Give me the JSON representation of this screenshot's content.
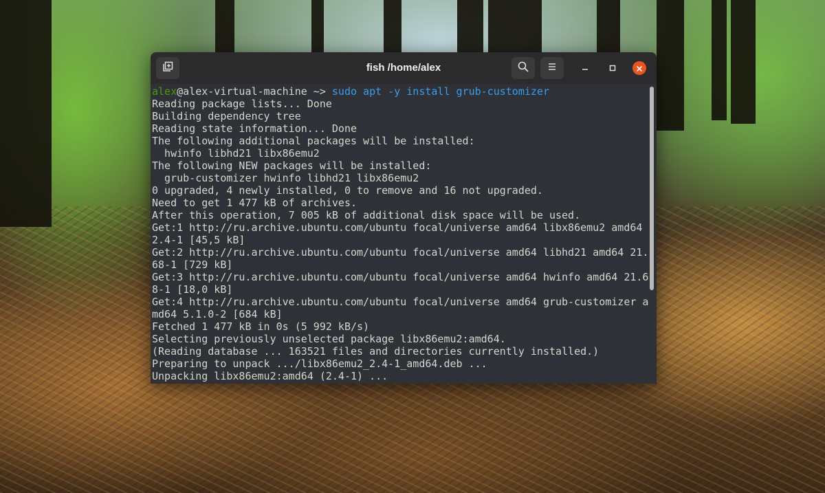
{
  "window": {
    "title": "fish /home/alex"
  },
  "colors": {
    "prompt_user": "#4e9a06",
    "command": "#3a9ded",
    "text": "#d3d7cf",
    "terminal_bg": "#2f3136",
    "close_button": "#e95420"
  },
  "icons": {
    "new_tab": "new-tab-icon",
    "search": "search-icon",
    "menu": "hamburger-menu-icon",
    "minimize": "minimize-icon",
    "maximize": "maximize-icon",
    "close": "close-icon"
  },
  "terminal": {
    "prompt_user": "alex",
    "prompt_rest": "@alex-virtual-machine ~> ",
    "command": "sudo apt -y install grub-customizer",
    "output": [
      "Reading package lists... Done",
      "Building dependency tree",
      "Reading state information... Done",
      "The following additional packages will be installed:",
      "  hwinfo libhd21 libx86emu2",
      "The following NEW packages will be installed:",
      "  grub-customizer hwinfo libhd21 libx86emu2",
      "0 upgraded, 4 newly installed, 0 to remove and 16 not upgraded.",
      "Need to get 1 477 kB of archives.",
      "After this operation, 7 005 kB of additional disk space will be used.",
      "Get:1 http://ru.archive.ubuntu.com/ubuntu focal/universe amd64 libx86emu2 amd64",
      "2.4-1 [45,5 kB]",
      "Get:2 http://ru.archive.ubuntu.com/ubuntu focal/universe amd64 libhd21 amd64 21.",
      "68-1 [729 kB]",
      "Get:3 http://ru.archive.ubuntu.com/ubuntu focal/universe amd64 hwinfo amd64 21.6",
      "8-1 [18,0 kB]",
      "Get:4 http://ru.archive.ubuntu.com/ubuntu focal/universe amd64 grub-customizer a",
      "md64 5.1.0-2 [684 kB]",
      "Fetched 1 477 kB in 0s (5 992 kB/s)",
      "Selecting previously unselected package libx86emu2:amd64.",
      "(Reading database ... 163521 files and directories currently installed.)",
      "Preparing to unpack .../libx86emu2_2.4-1_amd64.deb ...",
      "Unpacking libx86emu2:amd64 (2.4-1) ..."
    ]
  }
}
